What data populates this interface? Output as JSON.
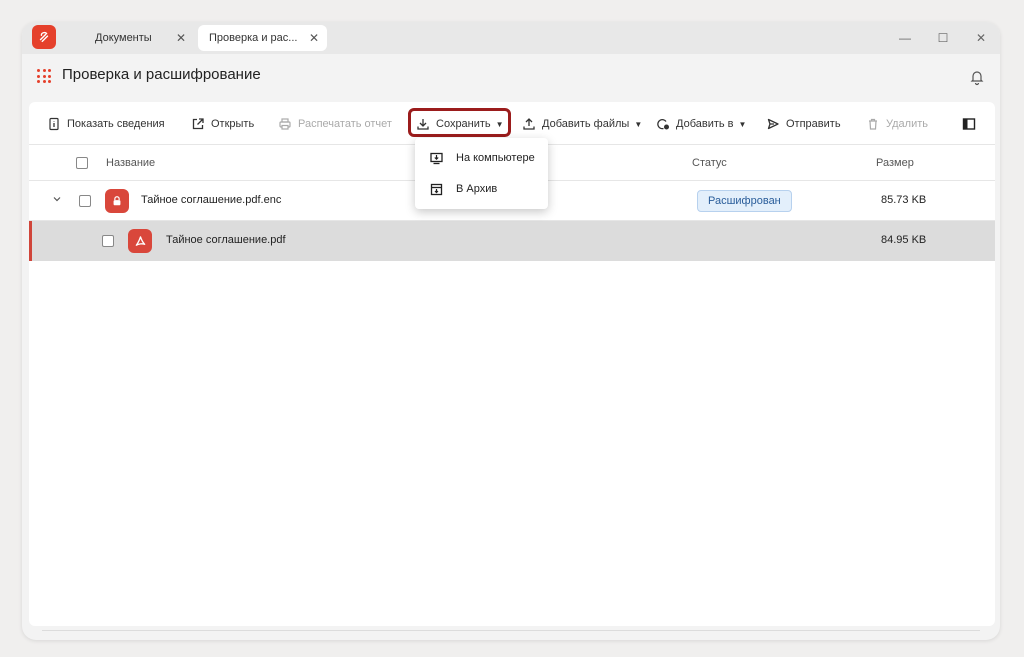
{
  "tabs": [
    {
      "label": "Документы"
    },
    {
      "label": "Проверка и рас..."
    }
  ],
  "window_controls": {
    "minimize": "—",
    "maximize": "☐",
    "close": "✕"
  },
  "page": {
    "title": "Проверка и расшифрование"
  },
  "toolbar": {
    "show_details": "Показать сведения",
    "open": "Открыть",
    "print_report": "Распечатать отчет",
    "save": "Сохранить",
    "add_files": "Добавить файлы",
    "add_to": "Добавить в",
    "send": "Отправить",
    "delete": "Удалить"
  },
  "save_menu": {
    "items": [
      {
        "label": "На компьютере",
        "icon": "computer-download-icon"
      },
      {
        "label": "В Архив",
        "icon": "archive-icon"
      }
    ]
  },
  "table": {
    "columns": {
      "name": "Название",
      "status": "Статус",
      "size": "Размер"
    },
    "rows": [
      {
        "name": "Тайное соглашение.pdf.enc",
        "status": "Расшифрован",
        "size": "85.73 KB",
        "icon": "lock-file-icon",
        "expanded": true
      },
      {
        "name": "Тайное соглашение.pdf",
        "status": "",
        "size": "84.95 KB",
        "icon": "pdf-icon",
        "selected": true
      }
    ]
  },
  "colors": {
    "accent": "#e5402b",
    "highlight_border": "#9b1c1c",
    "status_badge_bg": "#e3effb",
    "status_badge_text": "#2a5d9a"
  }
}
